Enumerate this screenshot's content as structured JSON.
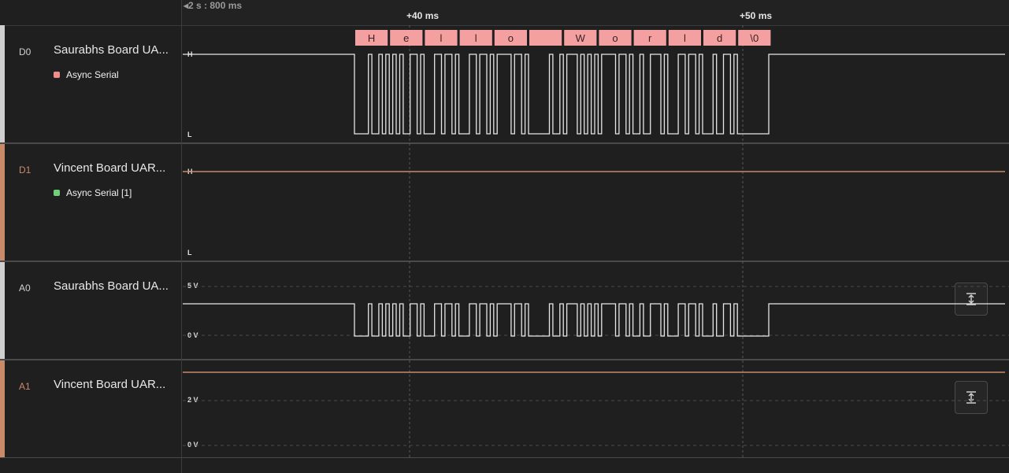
{
  "timeline": {
    "origin_label": "2 s : 800 ms",
    "markers": [
      {
        "label": "+40 ms"
      },
      {
        "label": "+50 ms"
      }
    ]
  },
  "decoded_bytes": [
    "H",
    "e",
    "l",
    "l",
    "o",
    " ",
    "W",
    "o",
    "r",
    "l",
    "d",
    "\\0"
  ],
  "channels": [
    {
      "id": "D0",
      "name": "Saurabhs Board UA...",
      "analyzer": "Async Serial",
      "analyzer_color": "#f28b8b",
      "color": "#cfcfcf",
      "level_high": "H",
      "level_low": "L"
    },
    {
      "id": "D1",
      "name": "Vincent Board UAR...",
      "analyzer": "Async Serial [1]",
      "analyzer_color": "#6fcf7a",
      "color": "#c98a6a",
      "level_high": "H",
      "level_low": "L"
    },
    {
      "id": "A0",
      "name": "Saurabhs Board UA...",
      "color": "#cfcfcf",
      "level_high": "5 V",
      "level_low": "0 V"
    },
    {
      "id": "A1",
      "name": "Vincent Board UAR...",
      "color": "#c98a6a",
      "level_high": "2 V",
      "level_low": "0 V"
    }
  ],
  "colors": {
    "decode_box": "#f4a0a0",
    "decode_text": "#3a2020",
    "waveform": "#e6e6e6",
    "orange_trace": "#c98a6a"
  },
  "icons": {
    "scale": "expand-vertical-icon"
  }
}
